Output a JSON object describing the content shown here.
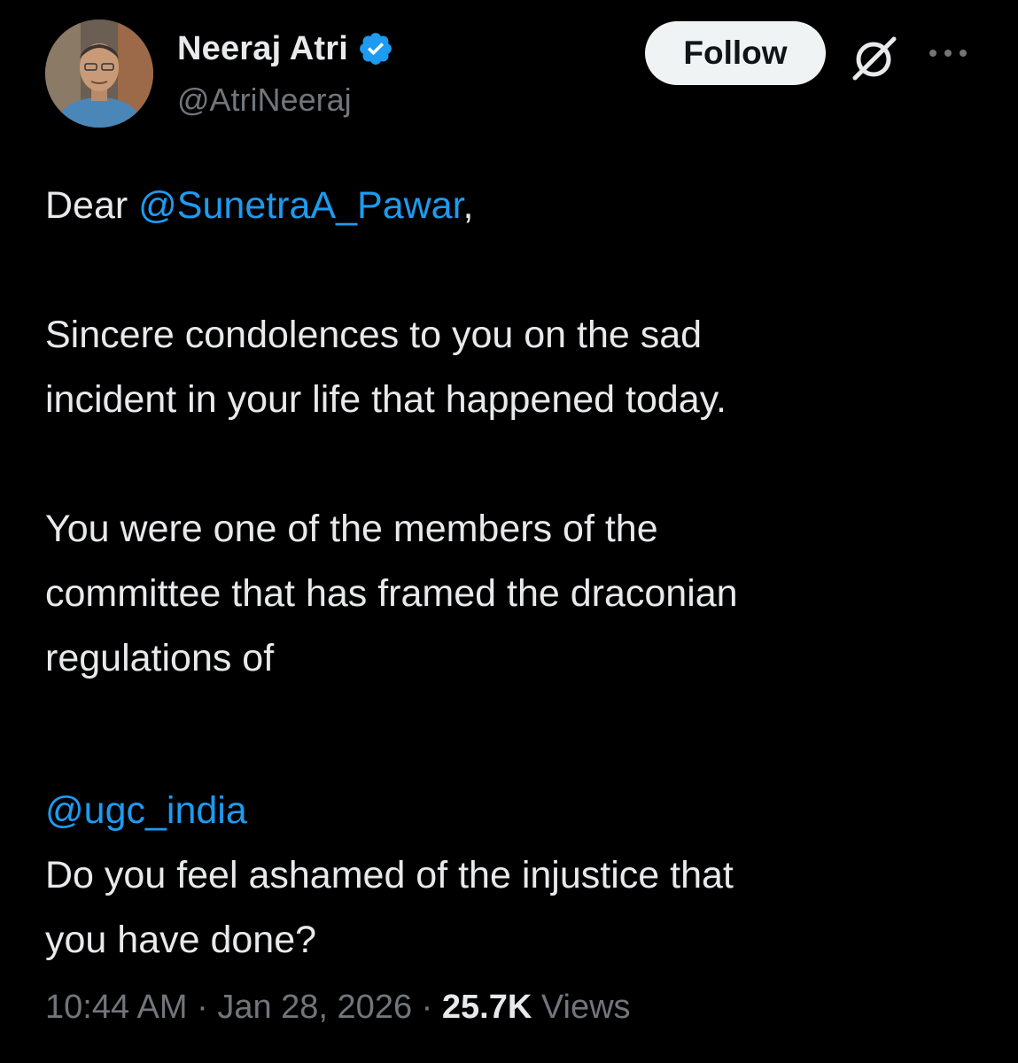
{
  "author": {
    "display_name": "Neeraj Atri",
    "handle": "@AtriNeeraj",
    "verified": true
  },
  "actions": {
    "follow_label": "Follow",
    "grok_icon": "grok-icon",
    "more_icon": "more-icon"
  },
  "tweet": {
    "greeting_prefix": "Dear ",
    "greeting_mention": "@SunetraA_Pawar",
    "greeting_suffix": ",",
    "para1_line1": "Sincere condolences to you on the sad",
    "para1_line2": "incident in your life that happened today.",
    "para2_line1": "You were one of the members of the",
    "para2_line2": "committee that has framed the draconian",
    "para2_line3": "regulations of",
    "mention2": "@ugc_india",
    "para3_line1": "Do you feel ashamed of the injustice that",
    "para3_line2": "you have done?"
  },
  "meta": {
    "time": "10:44 AM",
    "separator": "·",
    "date": "Jan 28, 2026",
    "views_count": "25.7K",
    "views_label": "Views"
  },
  "colors": {
    "background": "#000000",
    "text": "#e7e9ea",
    "secondary": "#71767b",
    "link": "#1d9bf0",
    "verified": "#1d9bf0",
    "follow_bg": "#eff3f4"
  }
}
